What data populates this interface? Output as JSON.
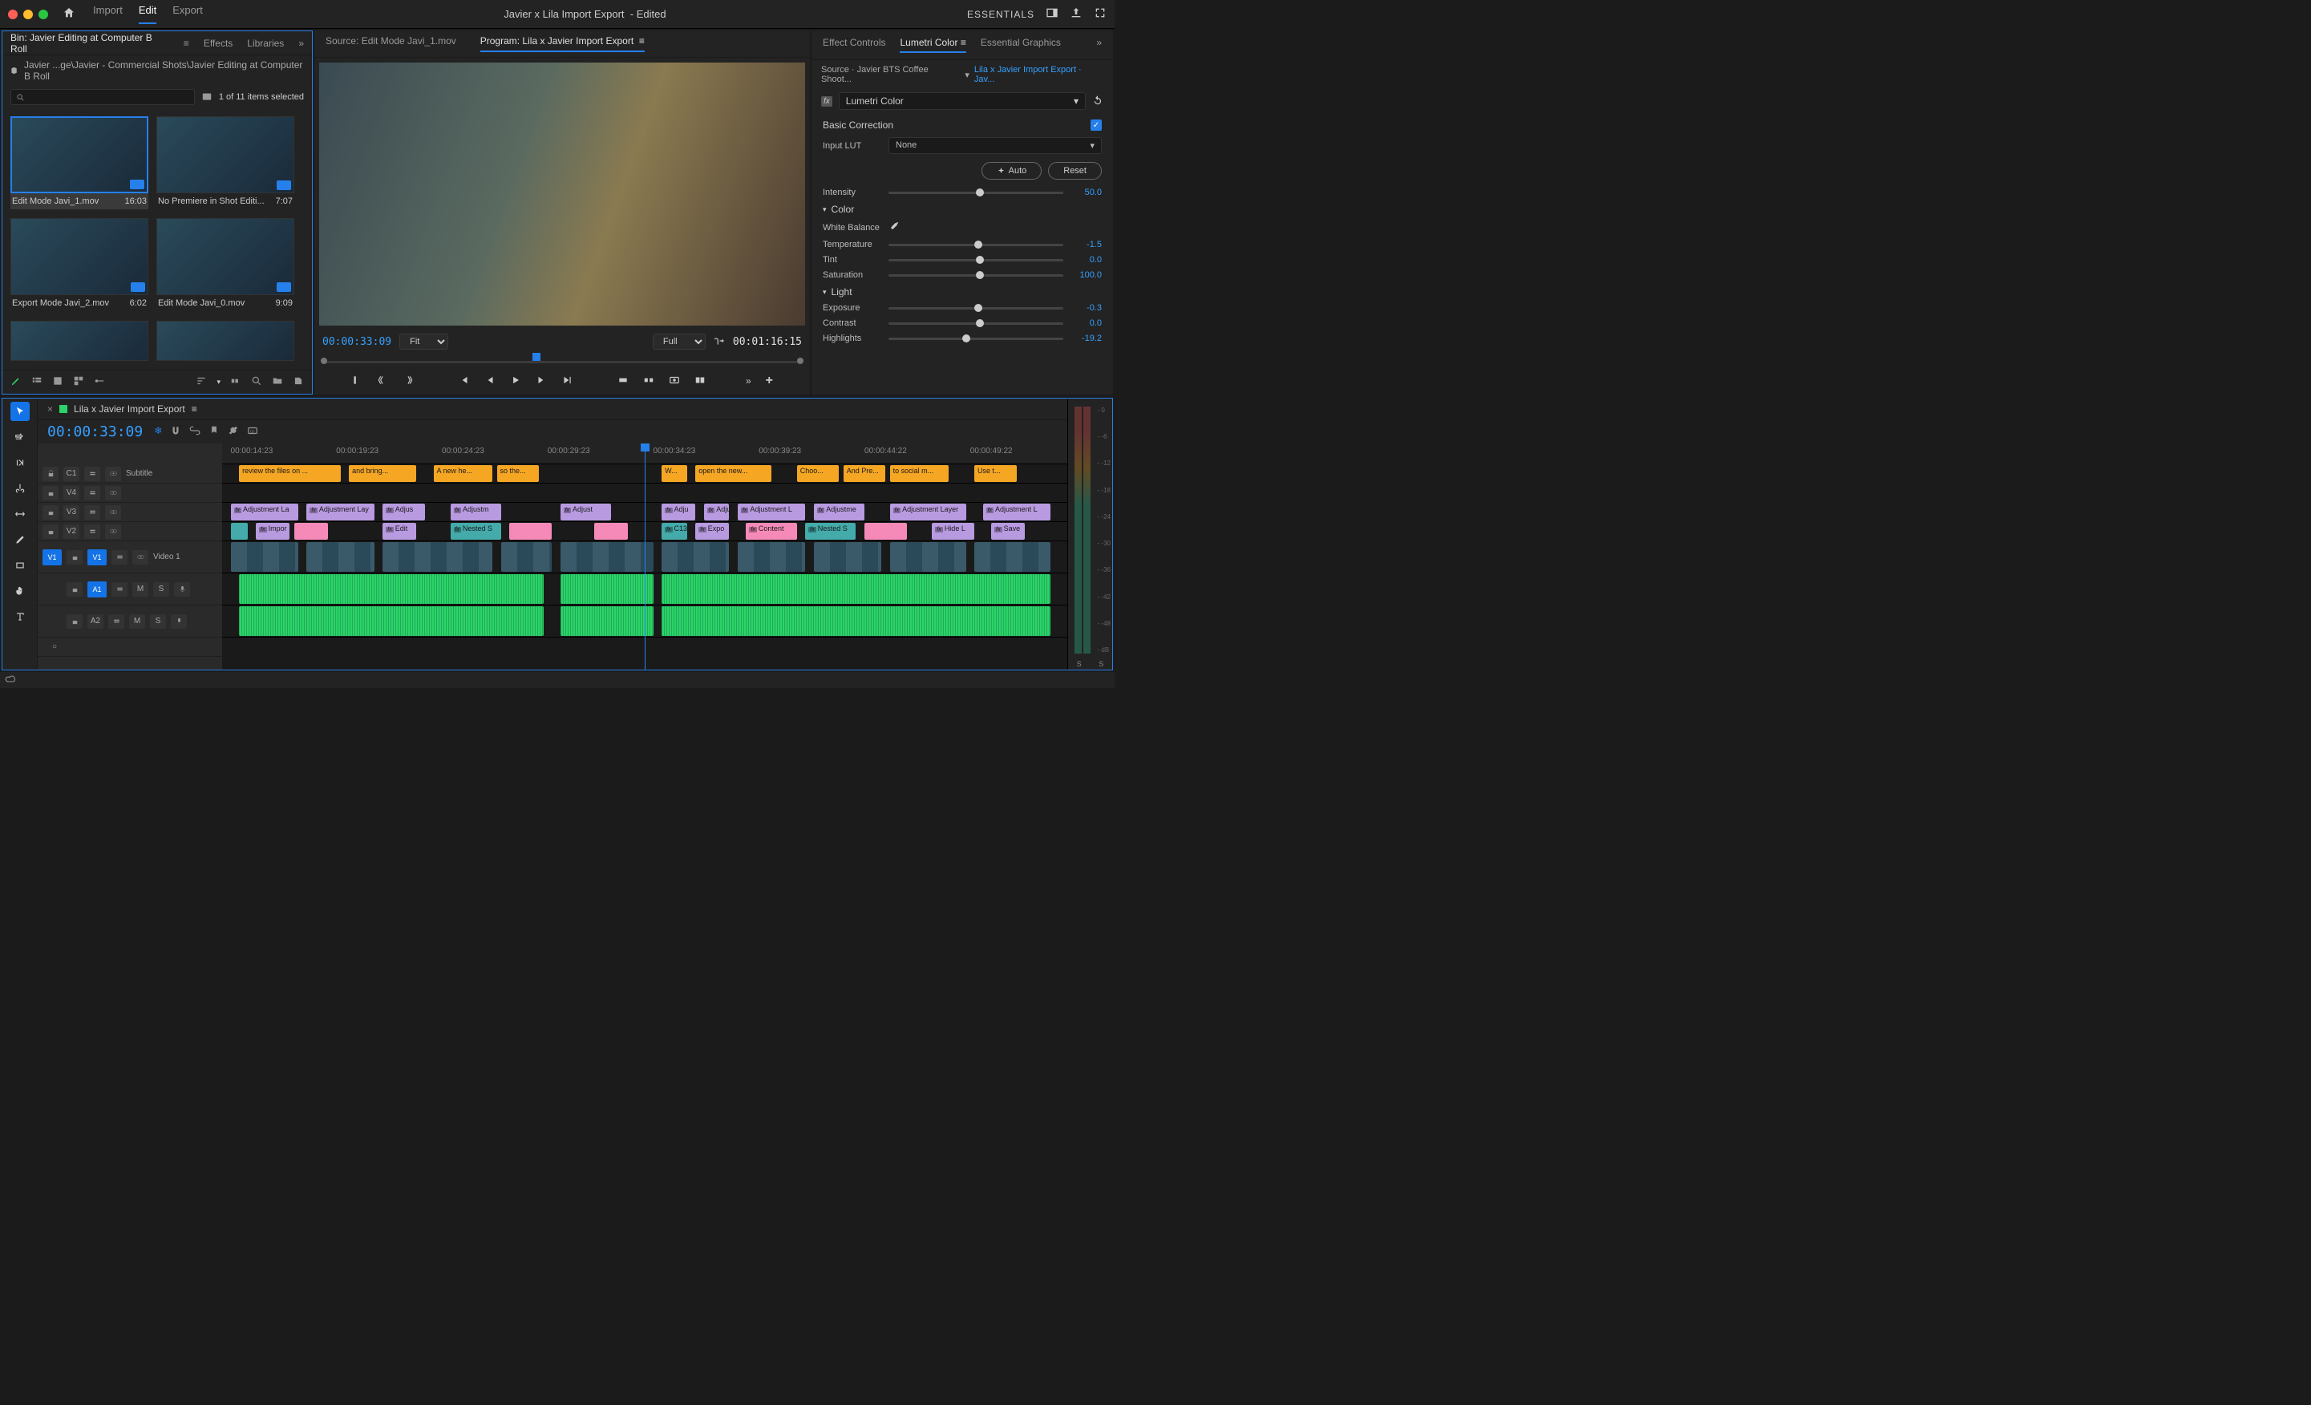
{
  "titlebar": {
    "menu": [
      "Import",
      "Edit",
      "Export"
    ],
    "active_menu": 1,
    "doc_title": "Javier x Lila Import Export",
    "doc_status": "Edited",
    "workspace": "ESSENTIALS"
  },
  "project": {
    "tabs": [
      "Bin: Javier Editing at Computer B Roll",
      "Effects",
      "Libraries"
    ],
    "breadcrumb": "Javier ...ge\\Javier - Commercial Shots\\Javier Editing at Computer B Roll",
    "search_placeholder": "",
    "selection": "1 of 11 items selected",
    "clips": [
      {
        "name": "Edit Mode Javi_1.mov",
        "dur": "16:03",
        "sel": true
      },
      {
        "name": "No Premiere in Shot Editi...",
        "dur": "7:07",
        "sel": false
      },
      {
        "name": "Export Mode Javi_2.mov",
        "dur": "6:02",
        "sel": false
      },
      {
        "name": "Edit Mode Javi_0.mov",
        "dur": "9:09",
        "sel": false
      }
    ]
  },
  "monitor": {
    "source_tab": "Source: Edit Mode Javi_1.mov",
    "program_tab": "Program: Lila x Javier Import Export",
    "tc_current": "00:00:33:09",
    "tc_duration": "00:01:16:15",
    "zoom": "Fit",
    "scale": "Full"
  },
  "lumetri": {
    "tabs": [
      "Effect Controls",
      "Lumetri Color",
      "Essential Graphics"
    ],
    "source": "Source · Javier BTS Coffee Shoot...",
    "sequence": "Lila x Javier Import Export · Jav...",
    "effect": "Lumetri Color",
    "section_basic": "Basic Correction",
    "input_lut_label": "Input LUT",
    "input_lut_value": "None",
    "auto": "Auto",
    "reset": "Reset",
    "color_label": "Color",
    "light_label": "Light",
    "wb_label": "White Balance",
    "params": {
      "intensity": {
        "label": "Intensity",
        "val": "50.0",
        "pos": 50
      },
      "temperature": {
        "label": "Temperature",
        "val": "-1.5",
        "pos": 49
      },
      "tint": {
        "label": "Tint",
        "val": "0.0",
        "pos": 50
      },
      "saturation": {
        "label": "Saturation",
        "val": "100.0",
        "pos": 50
      },
      "exposure": {
        "label": "Exposure",
        "val": "-0.3",
        "pos": 49
      },
      "contrast": {
        "label": "Contrast",
        "val": "0.0",
        "pos": 50
      },
      "highlights": {
        "label": "Highlights",
        "val": "-19.2",
        "pos": 42
      }
    }
  },
  "timeline": {
    "seq_name": "Lila x Javier Import Export",
    "tc": "00:00:33:09",
    "ruler": [
      "00:00:14:23",
      "00:00:19:23",
      "00:00:24:23",
      "00:00:29:23",
      "00:00:34:23",
      "00:00:39:23",
      "00:00:44:22",
      "00:00:49:22"
    ],
    "tracks": {
      "c1": "Subtitle",
      "v4": "",
      "v3": "",
      "v2": "",
      "v1": "Video 1",
      "a1": "",
      "a2": ""
    },
    "subtitles": [
      {
        "t": "review the files on ...",
        "l": 2,
        "w": 12
      },
      {
        "t": "and bring...",
        "l": 15,
        "w": 8
      },
      {
        "t": "A new he...",
        "l": 25,
        "w": 7
      },
      {
        "t": "so the...",
        "l": 32.5,
        "w": 5
      },
      {
        "t": "W...",
        "l": 52,
        "w": 3
      },
      {
        "t": "open the new...",
        "l": 56,
        "w": 9
      },
      {
        "t": "Choo...",
        "l": 68,
        "w": 5
      },
      {
        "t": "And Pre...",
        "l": 73.5,
        "w": 5
      },
      {
        "t": "to social m...",
        "l": 79,
        "w": 7
      },
      {
        "t": "Use t...",
        "l": 89,
        "w": 5
      }
    ],
    "v3_clips": [
      {
        "t": "Adjustment La",
        "l": 1,
        "w": 8
      },
      {
        "t": "Adjustment Lay",
        "l": 10,
        "w": 8
      },
      {
        "t": "Adjus",
        "l": 19,
        "w": 5
      },
      {
        "t": "Adjustm",
        "l": 27,
        "w": 6
      },
      {
        "t": "Adjust",
        "l": 40,
        "w": 6
      },
      {
        "t": "Adju",
        "l": 52,
        "w": 4
      },
      {
        "t": "Adju",
        "l": 57,
        "w": 3
      },
      {
        "t": "Adjustment L",
        "l": 61,
        "w": 8
      },
      {
        "t": "Adjustme",
        "l": 70,
        "w": 6
      },
      {
        "t": "Adjustment Layer",
        "l": 79,
        "w": 9
      },
      {
        "t": "Adjustment L",
        "l": 90,
        "w": 8
      }
    ],
    "v2_clips": [
      {
        "t": "",
        "l": 1,
        "w": 2,
        "c": "vid"
      },
      {
        "t": "Impor",
        "l": 4,
        "w": 4,
        "c": "adj"
      },
      {
        "t": "",
        "l": 8.5,
        "w": 4,
        "c": "pink"
      },
      {
        "t": "Edit",
        "l": 19,
        "w": 4,
        "c": "adj"
      },
      {
        "t": "Nested S",
        "l": 27,
        "w": 6,
        "c": "vid"
      },
      {
        "t": "",
        "l": 34,
        "w": 5,
        "c": "pink"
      },
      {
        "t": "",
        "l": 44,
        "w": 4,
        "c": "pink"
      },
      {
        "t": "C13",
        "l": 52,
        "w": 3,
        "c": "vid"
      },
      {
        "t": "Expo",
        "l": 56,
        "w": 4,
        "c": "adj"
      },
      {
        "t": "Content",
        "l": 62,
        "w": 6,
        "c": "pink"
      },
      {
        "t": "Nested S",
        "l": 69,
        "w": 6,
        "c": "vid"
      },
      {
        "t": "",
        "l": 76,
        "w": 5,
        "c": "pink"
      },
      {
        "t": "Hide L",
        "l": 84,
        "w": 5,
        "c": "adj"
      },
      {
        "t": "Save",
        "l": 91,
        "w": 4,
        "c": "adj"
      }
    ]
  },
  "meters": {
    "labels": [
      "0",
      "-6",
      "-12",
      "-18",
      "-24",
      "-30",
      "-36",
      "-42",
      "-48",
      "dB"
    ]
  }
}
